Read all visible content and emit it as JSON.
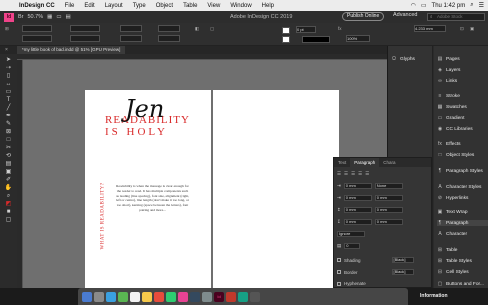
{
  "menubar": {
    "app": "InDesign CC",
    "items": [
      "File",
      "Edit",
      "Layout",
      "Type",
      "Object",
      "Table",
      "View",
      "Window",
      "Help"
    ],
    "time": "Thu 1:42 pm"
  },
  "control1": {
    "zoom": "50.7%",
    "title": "Adobe InDesign CC 2019",
    "publish_label": "Publish Online",
    "advanced_label": "Advanced",
    "search_placeholder": "Adobe Stock"
  },
  "control2": {
    "stroke_weight": "0 pt",
    "size_val": "4.233 mm",
    "zoom2": "100%"
  },
  "document_tab": {
    "label": "*my little book of bad.indd @ 51% [GPU Preview]"
  },
  "page": {
    "headline_line1": "READABILITY",
    "headline_line2": "IS HOLY",
    "script_overlay": "Jen",
    "vertical_title": "WHAT IS READABILITY?",
    "body_text": "Readability is when the message is clear enough for the reader to read. It has multiple components such as leading (line spacing), font size, alignment (right, left or centre), line length (don't make it too long, or too short), kerning (space between the letters), font pairing and more..."
  },
  "dock_col1": [
    {
      "icon": "glyphs-icon",
      "glyph": "Ω",
      "label": "Glyphs"
    }
  ],
  "dock_col2": [
    {
      "icon": "pages-icon",
      "glyph": "▤",
      "label": "Pages"
    },
    {
      "icon": "layers-icon",
      "glyph": "◈",
      "label": "Layers"
    },
    {
      "icon": "links-icon",
      "glyph": "∞",
      "label": "Links"
    },
    {
      "icon": "stroke-icon",
      "glyph": "≡",
      "label": "Stroke"
    },
    {
      "icon": "swatches-icon",
      "glyph": "▦",
      "label": "Swatches"
    },
    {
      "icon": "gradient-icon",
      "glyph": "▭",
      "label": "Gradient"
    },
    {
      "icon": "cc-libraries-icon",
      "glyph": "◉",
      "label": "CC Libraries"
    },
    {
      "icon": "effects-icon",
      "glyph": "fx",
      "label": "Effects"
    },
    {
      "icon": "object-styles-icon",
      "glyph": "□",
      "label": "Object Styles"
    },
    {
      "icon": "paragraph-styles-icon",
      "glyph": "¶",
      "label": "Paragraph Styles"
    },
    {
      "icon": "character-styles-icon",
      "glyph": "A",
      "label": "Character Styles"
    },
    {
      "icon": "hyperlinks-icon",
      "glyph": "⊘",
      "label": "Hyperlinks"
    },
    {
      "icon": "text-wrap-icon",
      "glyph": "▣",
      "label": "Text Wrap"
    },
    {
      "icon": "paragraph-icon",
      "glyph": "¶",
      "label": "Paragraph"
    },
    {
      "icon": "character-icon",
      "glyph": "A",
      "label": "Character"
    },
    {
      "icon": "table-icon",
      "glyph": "⊞",
      "label": "Table"
    },
    {
      "icon": "table-styles-icon",
      "glyph": "⊞",
      "label": "Table Styles"
    },
    {
      "icon": "cell-styles-icon",
      "glyph": "⊟",
      "label": "Cell Styles"
    },
    {
      "icon": "buttons-icon",
      "glyph": "▢",
      "label": "Buttons and For..."
    }
  ],
  "float_panel": {
    "tabs": [
      "Text",
      "Paragraph",
      "Chara"
    ],
    "indent_values": [
      "0 mm",
      "0 mm",
      "0 mm",
      "0 mm"
    ],
    "space_values": [
      "0 mm",
      "0 mm",
      "0 mm"
    ],
    "align_option": "None",
    "ignore_option": "Ignore",
    "zero_value": "0",
    "shading_label": "Shading",
    "border_label": "Border",
    "hyphenate_label": "Hyphenate",
    "black_label": "[Black]",
    "black_label2": "[Black]"
  },
  "status": {
    "information_label": "Information"
  },
  "colors": {
    "accent_red": "#d92a2a",
    "indesign_pink": "#f0438a"
  }
}
